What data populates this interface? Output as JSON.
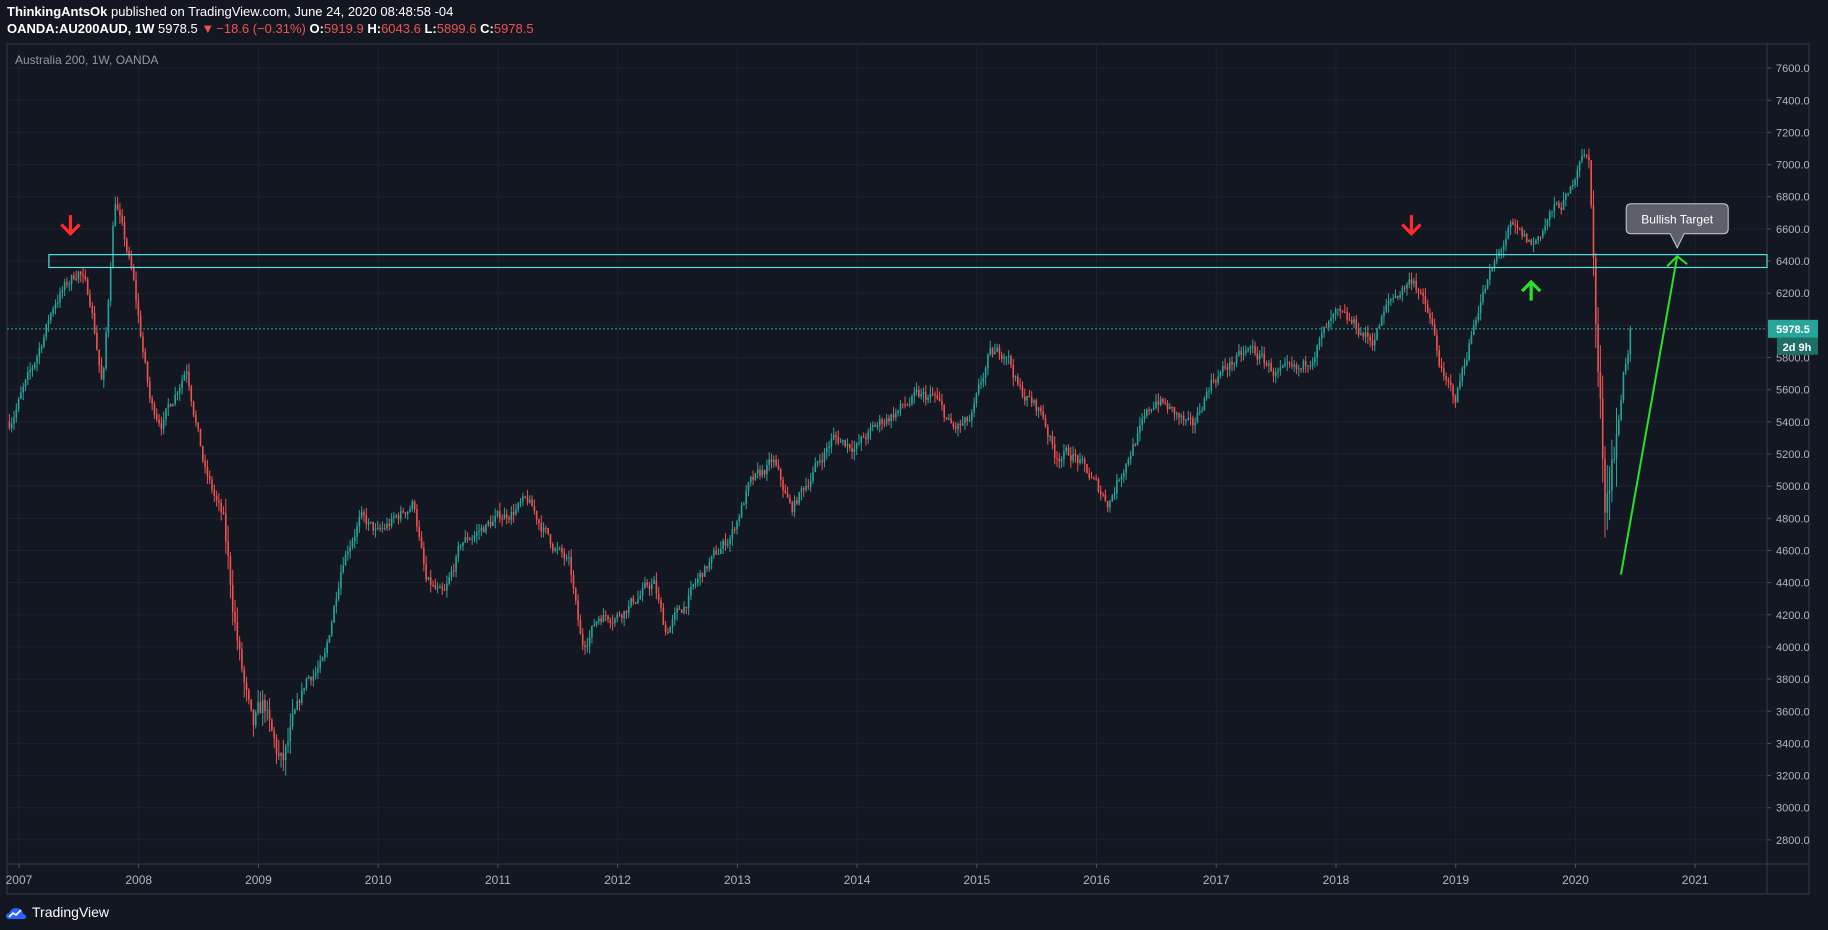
{
  "header": {
    "author": "ThinkingAntsOk",
    "published": "published on TradingView.com, June 24, 2020 08:48:58 -04",
    "symbol": "OANDA:AU200AUD, 1W",
    "price": "5978.5",
    "change": "−18.6 (−0.31%)",
    "o_label": "O:",
    "o": "5919.9",
    "h_label": "H:",
    "h": "6043.6",
    "l_label": "L:",
    "l": "5899.6",
    "c_label": "C:",
    "c": "5978.5"
  },
  "footer": {
    "brand": "TradingView"
  },
  "colors": {
    "background": "#131722",
    "up": "#26a69a",
    "down": "#ef5350",
    "zone": "#56e0e0",
    "green_arrow": "#28e228",
    "red_arrow": "#ff2b2b",
    "price_label": "#26a69a"
  },
  "chart_data": {
    "type": "candlestick",
    "title": "Australia 200, 1W, OANDA",
    "x_ticks": [
      "2007",
      "2008",
      "2009",
      "2010",
      "2011",
      "2012",
      "2013",
      "2014",
      "2015",
      "2016",
      "2017",
      "2018",
      "2019",
      "2020",
      "2021"
    ],
    "y_ticks": [
      "7600.0",
      "7400.0",
      "7200.0",
      "7000.0",
      "6800.0",
      "6600.0",
      "6400.0",
      "6200.0",
      "6000.0",
      "5800.0",
      "5600.0",
      "5400.0",
      "5200.0",
      "5000.0",
      "4800.0",
      "4600.0",
      "4400.0",
      "4200.0",
      "4000.0",
      "3800.0",
      "3600.0",
      "3400.0",
      "3200.0",
      "3000.0",
      "2800.0"
    ],
    "ylim": [
      2650,
      7750
    ],
    "xlim": [
      2006.9,
      2021.6
    ],
    "anchors": [
      [
        2006.92,
        5400
      ],
      [
        2007.1,
        5700
      ],
      [
        2007.3,
        6150
      ],
      [
        2007.5,
        6350
      ],
      [
        2007.6,
        6150
      ],
      [
        2007.7,
        5600
      ],
      [
        2007.8,
        6800
      ],
      [
        2007.95,
        6300
      ],
      [
        2008.1,
        5500
      ],
      [
        2008.2,
        5400
      ],
      [
        2008.4,
        5750
      ],
      [
        2008.55,
        5100
      ],
      [
        2008.7,
        4800
      ],
      [
        2008.85,
        3900
      ],
      [
        2008.95,
        3450
      ],
      [
        2009.05,
        3650
      ],
      [
        2009.1,
        3450
      ],
      [
        2009.2,
        3250
      ],
      [
        2009.4,
        3800
      ],
      [
        2009.55,
        3900
      ],
      [
        2009.7,
        4550
      ],
      [
        2009.85,
        4800
      ],
      [
        2010.0,
        4700
      ],
      [
        2010.3,
        4900
      ],
      [
        2010.4,
        4400
      ],
      [
        2010.55,
        4300
      ],
      [
        2010.7,
        4650
      ],
      [
        2011.0,
        4800
      ],
      [
        2011.25,
        4900
      ],
      [
        2011.45,
        4650
      ],
      [
        2011.6,
        4500
      ],
      [
        2011.7,
        4000
      ],
      [
        2011.85,
        4200
      ],
      [
        2012.0,
        4200
      ],
      [
        2012.3,
        4400
      ],
      [
        2012.4,
        4100
      ],
      [
        2012.55,
        4250
      ],
      [
        2012.7,
        4450
      ],
      [
        2012.95,
        4700
      ],
      [
        2013.1,
        5000
      ],
      [
        2013.3,
        5150
      ],
      [
        2013.45,
        4850
      ],
      [
        2013.6,
        5050
      ],
      [
        2013.8,
        5300
      ],
      [
        2014.0,
        5250
      ],
      [
        2014.2,
        5400
      ],
      [
        2014.5,
        5550
      ],
      [
        2014.65,
        5550
      ],
      [
        2014.8,
        5350
      ],
      [
        2014.95,
        5400
      ],
      [
        2015.1,
        5800
      ],
      [
        2015.25,
        5850
      ],
      [
        2015.35,
        5600
      ],
      [
        2015.55,
        5450
      ],
      [
        2015.65,
        5200
      ],
      [
        2015.8,
        5200
      ],
      [
        2015.95,
        5050
      ],
      [
        2016.1,
        4900
      ],
      [
        2016.3,
        5250
      ],
      [
        2016.5,
        5550
      ],
      [
        2016.65,
        5450
      ],
      [
        2016.8,
        5350
      ],
      [
        2016.95,
        5650
      ],
      [
        2017.1,
        5750
      ],
      [
        2017.3,
        5850
      ],
      [
        2017.5,
        5700
      ],
      [
        2017.7,
        5700
      ],
      [
        2017.9,
        5950
      ],
      [
        2018.0,
        6050
      ],
      [
        2018.15,
        6000
      ],
      [
        2018.3,
        5900
      ],
      [
        2018.45,
        6150
      ],
      [
        2018.65,
        6300
      ],
      [
        2018.8,
        6000
      ],
      [
        2018.9,
        5650
      ],
      [
        2019.0,
        5550
      ],
      [
        2019.05,
        5700
      ],
      [
        2019.2,
        6150
      ],
      [
        2019.45,
        6600
      ],
      [
        2019.55,
        6550
      ],
      [
        2019.65,
        6500
      ],
      [
        2019.8,
        6700
      ],
      [
        2019.95,
        6800
      ],
      [
        2020.05,
        7100
      ],
      [
        2020.12,
        7000
      ],
      [
        2020.18,
        5800
      ],
      [
        2020.25,
        4900
      ],
      [
        2020.3,
        5200
      ],
      [
        2020.35,
        5300
      ],
      [
        2020.4,
        5700
      ],
      [
        2020.47,
        5980
      ]
    ],
    "resistance_zone": {
      "y_top": 6440,
      "y_bottom": 6360,
      "x_start": 2007.25,
      "x_end": 2021.6
    },
    "current_price_line": 5978.5,
    "projection": {
      "from": [
        2020.38,
        4450
      ],
      "to": [
        2020.85,
        6430
      ]
    },
    "arrows": [
      {
        "type": "down",
        "x": 2007.43,
        "y": 6620,
        "color": "red"
      },
      {
        "type": "down",
        "x": 2018.63,
        "y": 6620,
        "color": "red"
      },
      {
        "type": "up",
        "x": 2019.63,
        "y": 6220,
        "color": "green"
      }
    ],
    "annotation": {
      "text": "Bullish Target",
      "x": 2020.85,
      "y": 6570
    },
    "price_label": "5978.5",
    "countdown_label": "2d 9h",
    "seed": 7
  }
}
